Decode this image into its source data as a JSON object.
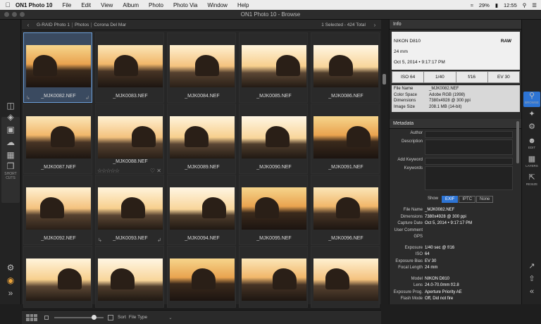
{
  "menubar": {
    "app": "ON1 Photo 10",
    "items": [
      "File",
      "Edit",
      "View",
      "Album",
      "Photo",
      "Photo Via",
      "Window",
      "Help"
    ],
    "battery": "29%",
    "clock": "12:55",
    "extras": [
      "wifi-icon",
      "battery-icon",
      "search-icon",
      "menu-icon"
    ]
  },
  "window": {
    "title": "ON1 Photo 10 - Browse"
  },
  "breadcrumb": {
    "segments": [
      "G-RAID Photo 1",
      "Photos",
      "Corona Del Mar"
    ],
    "count": "1 Selected - 424 Total"
  },
  "left_toolbar": {
    "shortcuts_label": "SHORT CUTS"
  },
  "grid": {
    "files": [
      "_MJK0082.NEF",
      "_MJK0083.NEF",
      "_MJK0084.NEF",
      "_MJK0085.NEF",
      "_MJK0086.NEF",
      "_MJK0087.NEF",
      "_MJK0088.NEF",
      "_MJK0089.NEF",
      "_MJK0090.NEF",
      "_MJK0091.NEF",
      "_MJK0092.NEF",
      "_MJK0093.NEF",
      "_MJK0094.NEF",
      "_MJK0095.NEF",
      "_MJK0096.NEF",
      "",
      "",
      "",
      "",
      ""
    ],
    "selected_index": 0
  },
  "bottombar": {
    "sort_label": "Sort",
    "sort_value": "File Type",
    "zoom": 0.75
  },
  "info": {
    "header": "Info",
    "camera": "NIKON D810",
    "raw": "RAW",
    "lens": "24 mm",
    "date": "Oct 5, 2014 • 9:17:17 PM",
    "exif": [
      "ISO 64",
      "1/40",
      "f/16",
      "EV 30"
    ],
    "file": [
      {
        "k": "File Name",
        "v": "_MJK0082.NEF"
      },
      {
        "k": "Color Space",
        "v": "Adobe RGB (1998)"
      },
      {
        "k": "Dimensions",
        "v": "7380x4928 @ 300 ppi"
      },
      {
        "k": "Image Size",
        "v": "208.1 MB (14-bit)"
      }
    ]
  },
  "metadata": {
    "header": "Metadata",
    "fields": [
      "Author",
      "Description",
      "Add Keyword",
      "Keywords"
    ],
    "show_label": "Show",
    "tabs": [
      "EXIF",
      "IPTC",
      "None"
    ],
    "exif1": [
      {
        "k": "File Name",
        "v": "_MJK0082.NEF"
      },
      {
        "k": "Dimensions",
        "v": "7380x4928 @ 300 ppi"
      },
      {
        "k": "Capture Date",
        "v": "Oct 5, 2014 • 9:17:17 PM"
      },
      {
        "k": "User Comment",
        "v": ""
      },
      {
        "k": "GPS",
        "v": ""
      }
    ],
    "exif2": [
      {
        "k": "Exposure",
        "v": "1/40 sec @ f/16"
      },
      {
        "k": "ISO",
        "v": "64"
      },
      {
        "k": "Exposure Bias",
        "v": "EV 30"
      },
      {
        "k": "Focal Length",
        "v": "24 mm"
      }
    ],
    "exif3": [
      {
        "k": "Model",
        "v": "NIKON D810"
      },
      {
        "k": "Lens",
        "v": "24.0-70.0mm f/2.8"
      },
      {
        "k": "Exposure Prog.",
        "v": "Aperture Priority AE"
      },
      {
        "k": "Flash Mode",
        "v": "Off, Did not fire"
      }
    ]
  },
  "right_toolbar": [
    "BROWSE",
    "",
    "",
    "EDIT",
    "LAYERS",
    "RESIZE"
  ],
  "colors": {
    "accent": "#2d74d4",
    "selection": "#6c9ed6"
  }
}
